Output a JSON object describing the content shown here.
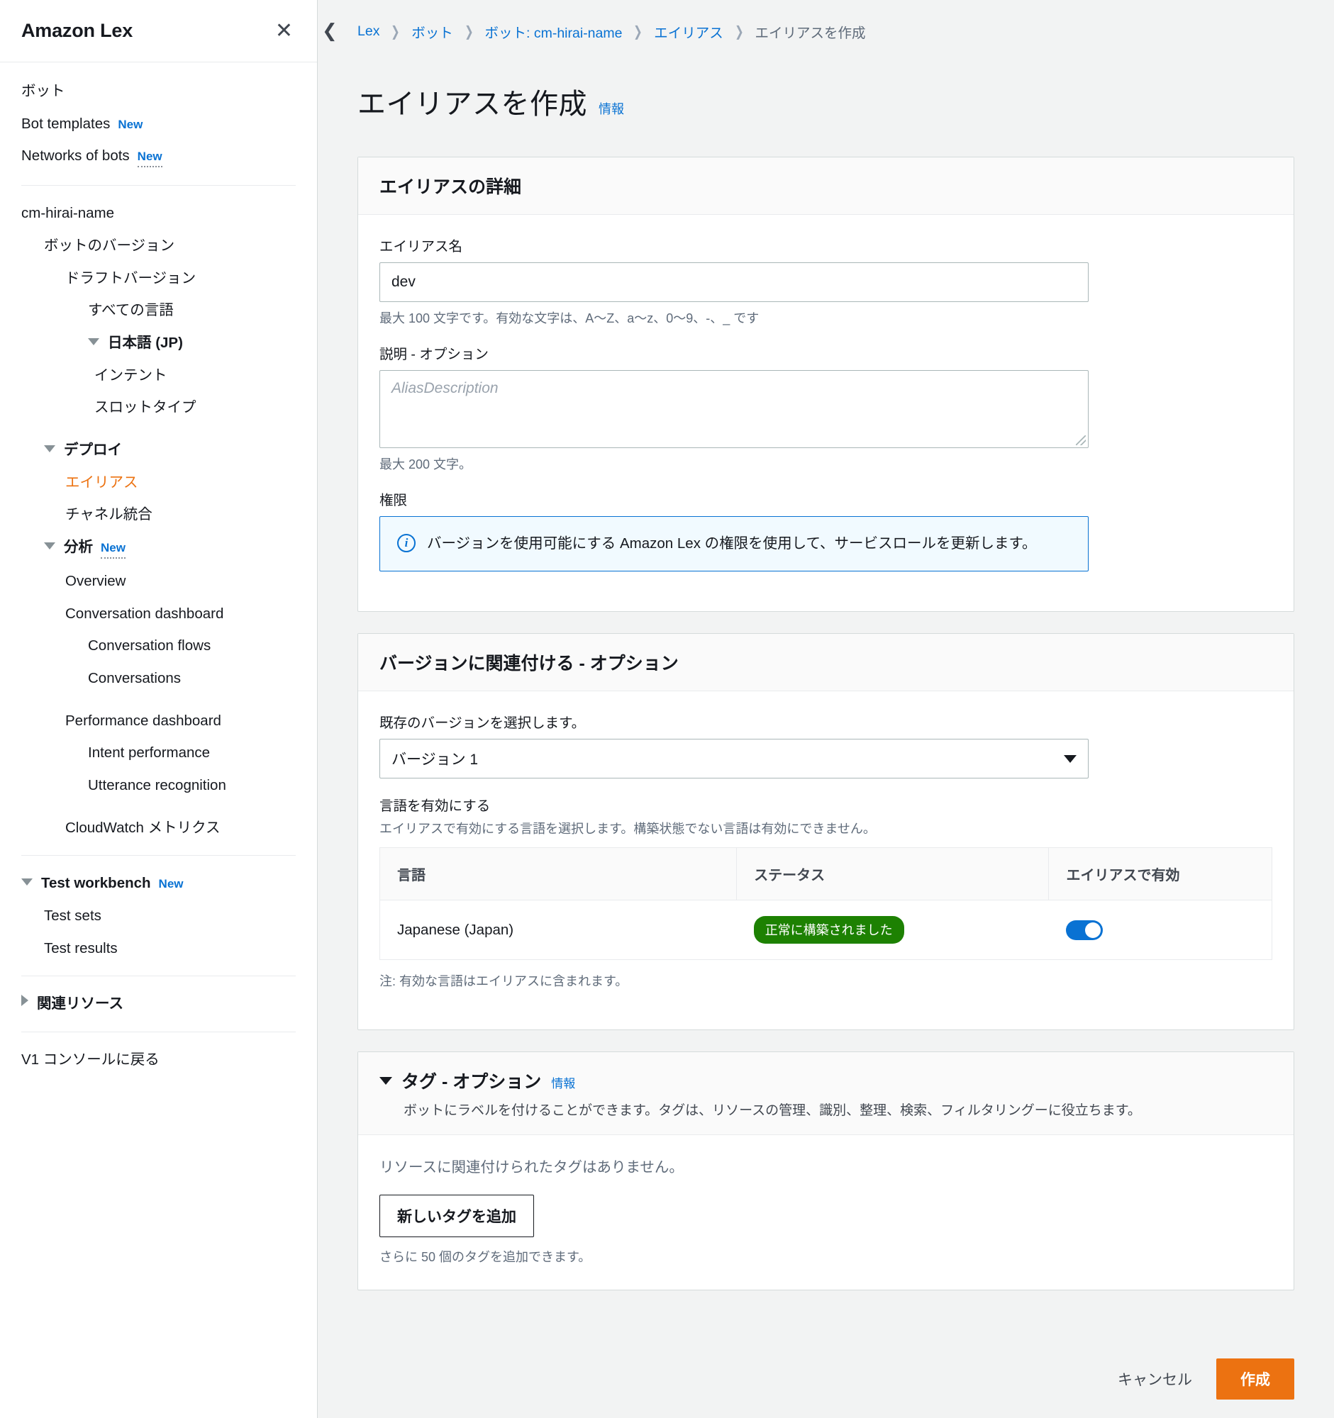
{
  "sidebar": {
    "title": "Amazon Lex",
    "close_icon": "close-icon",
    "items": [
      {
        "label": "ボット",
        "indent": 0,
        "bold": false,
        "badge": null,
        "tri": null,
        "active": false
      },
      {
        "label": "Bot templates",
        "indent": 0,
        "bold": false,
        "badge": "New",
        "badge_dotted": false,
        "tri": null,
        "active": false
      },
      {
        "label": "Networks of bots",
        "indent": 0,
        "bold": false,
        "badge": "New",
        "badge_dotted": true,
        "tri": null,
        "active": false
      },
      {
        "sep": true
      },
      {
        "label": "cm-hirai-name",
        "indent": 0,
        "bold": false,
        "badge": null,
        "tri": null,
        "active": false
      },
      {
        "label": "ボットのバージョン",
        "indent": 1,
        "bold": false,
        "badge": null,
        "tri": null,
        "active": false
      },
      {
        "label": "ドラフトバージョン",
        "indent": 2,
        "bold": false,
        "badge": null,
        "tri": null,
        "active": false
      },
      {
        "label": "すべての言語",
        "indent": 3,
        "bold": false,
        "badge": null,
        "tri": null,
        "active": false
      },
      {
        "label": "日本語 (JP)",
        "indent": 3,
        "bold": true,
        "badge": null,
        "tri": "down",
        "active": false
      },
      {
        "label": "インテント",
        "indent": 4,
        "bold": false,
        "badge": null,
        "tri": null,
        "active": false
      },
      {
        "label": "スロットタイプ",
        "indent": 4,
        "bold": false,
        "badge": null,
        "tri": null,
        "active": false
      },
      {
        "gap": true
      },
      {
        "label": "デプロイ",
        "indent": 1,
        "bold": true,
        "badge": null,
        "tri": "down",
        "active": false
      },
      {
        "label": "エイリアス",
        "indent": 2,
        "bold": false,
        "badge": null,
        "tri": null,
        "active": true
      },
      {
        "label": "チャネル統合",
        "indent": 2,
        "bold": false,
        "badge": null,
        "tri": null,
        "active": false
      },
      {
        "label": "分析",
        "indent": 1,
        "bold": true,
        "badge": "New",
        "badge_dotted": true,
        "tri": "down",
        "active": false
      },
      {
        "label": "Overview",
        "indent": 2,
        "bold": false,
        "badge": null,
        "tri": null,
        "active": false
      },
      {
        "label": "Conversation dashboard",
        "indent": 2,
        "bold": false,
        "badge": null,
        "tri": null,
        "active": false
      },
      {
        "label": "Conversation flows",
        "indent": 3,
        "bold": false,
        "badge": null,
        "tri": null,
        "active": false
      },
      {
        "label": "Conversations",
        "indent": 3,
        "bold": false,
        "badge": null,
        "tri": null,
        "active": false
      },
      {
        "gap": true
      },
      {
        "label": "Performance dashboard",
        "indent": 2,
        "bold": false,
        "badge": null,
        "tri": null,
        "active": false
      },
      {
        "label": "Intent performance",
        "indent": 3,
        "bold": false,
        "badge": null,
        "tri": null,
        "active": false
      },
      {
        "label": "Utterance recognition",
        "indent": 3,
        "bold": false,
        "badge": null,
        "tri": null,
        "active": false
      },
      {
        "gap": true
      },
      {
        "label": "CloudWatch メトリクス",
        "indent": 2,
        "bold": false,
        "badge": null,
        "tri": null,
        "active": false
      },
      {
        "sep": true
      },
      {
        "label": "Test workbench",
        "indent": 0,
        "bold": true,
        "badge": "New",
        "badge_dotted": false,
        "tri": "down",
        "active": false
      },
      {
        "label": "Test sets",
        "indent": 1,
        "bold": false,
        "badge": null,
        "tri": null,
        "active": false
      },
      {
        "label": "Test results",
        "indent": 1,
        "bold": false,
        "badge": null,
        "tri": null,
        "active": false
      },
      {
        "sep": true
      },
      {
        "label": "関連リソース",
        "indent": 0,
        "bold": true,
        "badge": null,
        "tri": "right",
        "active": false
      },
      {
        "sep": true
      },
      {
        "label": "V1 コンソールに戻る",
        "indent": 0,
        "bold": false,
        "badge": null,
        "tri": null,
        "active": false
      }
    ]
  },
  "breadcrumb": {
    "collapse_icon": "chevron-left-icon",
    "items": [
      "Lex",
      "ボット",
      "ボット: cm-hirai-name",
      "エイリアス",
      "エイリアスを作成"
    ],
    "separator": "❯"
  },
  "page": {
    "title": "エイリアスを作成",
    "info_link": "情報"
  },
  "alias_details": {
    "card_title": "エイリアスの詳細",
    "name_label": "エイリアス名",
    "name_value": "dev",
    "name_constraint": "最大 100 文字です。有効な文字は、A〜Z、a〜z、0〜9、-、_ です",
    "description_label": "説明 - オプション",
    "description_placeholder": "AliasDescription",
    "description_constraint": "最大 200 文字。",
    "permission_label": "権限",
    "alert_icon": "info-circle-icon",
    "alert_text": "バージョンを使用可能にする Amazon Lex の権限を使用して、サービスロールを更新します。"
  },
  "version_association": {
    "card_title": "バージョンに関連付ける - オプション",
    "select_label": "既存のバージョンを選択します。",
    "select_value": "バージョン 1",
    "select_caret": "chevron-down-icon",
    "languages_label": "言語を有効にする",
    "languages_desc": "エイリアスで有効にする言語を選択します。構築状態でない言語は有効にできません。",
    "table_headers": [
      "言語",
      "ステータス",
      "エイリアスで有効"
    ],
    "rows": [
      {
        "language": "Japanese (Japan)",
        "status": "正常に構築されました",
        "enabled": true
      }
    ],
    "note": "注: 有効な言語はエイリアスに含まれます。"
  },
  "tags": {
    "collapse_icon": "chevron-down-icon",
    "card_title": "タグ - オプション",
    "info_link": "情報",
    "subtitle": "ボットにラベルを付けることができます。タグは、リソースの管理、識別、整理、検索、フィルタリングーに役立ちます。",
    "empty_text": "リソースに関連付けられたタグはありません。",
    "add_button": "新しいタグを追加",
    "limit_note": "さらに 50 個のタグを追加できます。"
  },
  "footer": {
    "cancel_label": "キャンセル",
    "create_label": "作成"
  },
  "colors": {
    "accent_orange": "#ec7211",
    "link_blue": "#0972d3",
    "status_green": "#1d8102",
    "alert_bg": "#f1faff"
  }
}
